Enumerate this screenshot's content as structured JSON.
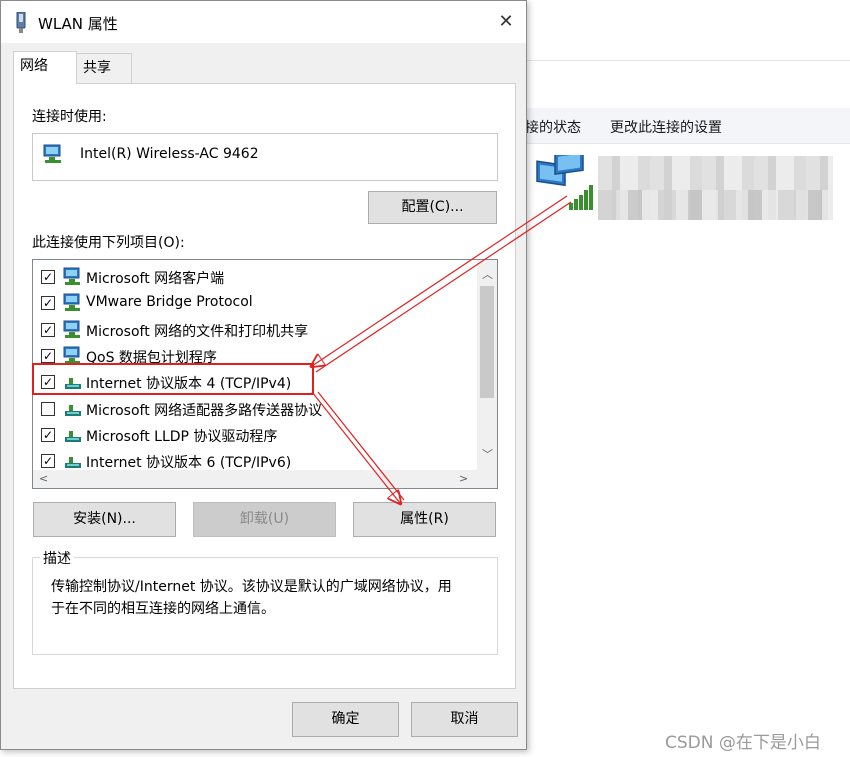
{
  "background_window": {
    "toolbar_item_1": "接的状态",
    "toolbar_item_2": "更改此连接的设置"
  },
  "dialog": {
    "title": "WLAN 属性",
    "close_glyph": "✕",
    "tabs": [
      {
        "label": "网络",
        "active": true
      },
      {
        "label": "共享",
        "active": false
      }
    ],
    "connect_using_label": "连接时使用:",
    "adapter_name": "Intel(R) Wireless-AC 9462",
    "configure_button": "配置(C)...",
    "items_label": "此连接使用下列项目(O):",
    "items": [
      {
        "checked": true,
        "label": "Microsoft 网络客户端",
        "icon": "network-client-icon"
      },
      {
        "checked": true,
        "label": "VMware Bridge Protocol",
        "icon": "network-client-icon"
      },
      {
        "checked": true,
        "label": "Microsoft 网络的文件和打印机共享",
        "icon": "network-client-icon"
      },
      {
        "checked": true,
        "label": "QoS 数据包计划程序",
        "icon": "network-client-icon"
      },
      {
        "checked": true,
        "label": "Internet 协议版本 4 (TCP/IPv4)",
        "icon": "protocol-icon",
        "highlighted": true
      },
      {
        "checked": false,
        "label": "Microsoft 网络适配器多路传送器协议",
        "icon": "protocol-icon"
      },
      {
        "checked": true,
        "label": "Microsoft LLDP 协议驱动程序",
        "icon": "protocol-icon"
      },
      {
        "checked": true,
        "label": "Internet 协议版本 6 (TCP/IPv6)",
        "icon": "protocol-icon"
      }
    ],
    "install_button": "安装(N)...",
    "uninstall_button": "卸载(U)",
    "properties_button": "属性(R)",
    "description_title": "描述",
    "description_text_line1": "传输控制协议/Internet 协议。该协议是默认的广域网络协议，用",
    "description_text_line2": "于在不同的相互连接的网络上通信。",
    "ok_button": "确定",
    "cancel_button": "取消"
  },
  "watermark": "CSDN @在下是小白",
  "colors": {
    "annotation_red": "#e02020",
    "checkbox_border": "#333333",
    "dialog_bg": "#f0f0f0"
  }
}
